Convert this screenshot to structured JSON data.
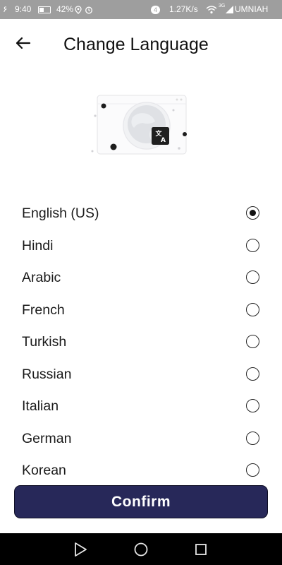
{
  "status_bar": {
    "carrier_left": "۶",
    "time": "9:40",
    "battery": "42%",
    "notification_count": "4",
    "network_speed": "1.27K/s",
    "network_type": "3G",
    "carrier": "UMNIAH"
  },
  "header": {
    "title": "Change Language"
  },
  "languages": [
    {
      "label": "English (US)",
      "selected": true
    },
    {
      "label": "Hindi",
      "selected": false
    },
    {
      "label": "Arabic",
      "selected": false
    },
    {
      "label": "French",
      "selected": false
    },
    {
      "label": "Turkish",
      "selected": false
    },
    {
      "label": "Russian",
      "selected": false
    },
    {
      "label": "Italian",
      "selected": false
    },
    {
      "label": "German",
      "selected": false
    },
    {
      "label": "Korean",
      "selected": false
    }
  ],
  "confirm_label": "Confirm",
  "icons": {
    "back": "arrow-left-icon",
    "illustration": "globe-translate-icon",
    "nav_back": "triangle-back-icon",
    "nav_home": "circle-home-icon",
    "nav_recents": "square-recents-icon"
  },
  "colors": {
    "primary_button": "#272859",
    "status_bar": "#9e9e9e",
    "nav_bar": "#000000"
  }
}
